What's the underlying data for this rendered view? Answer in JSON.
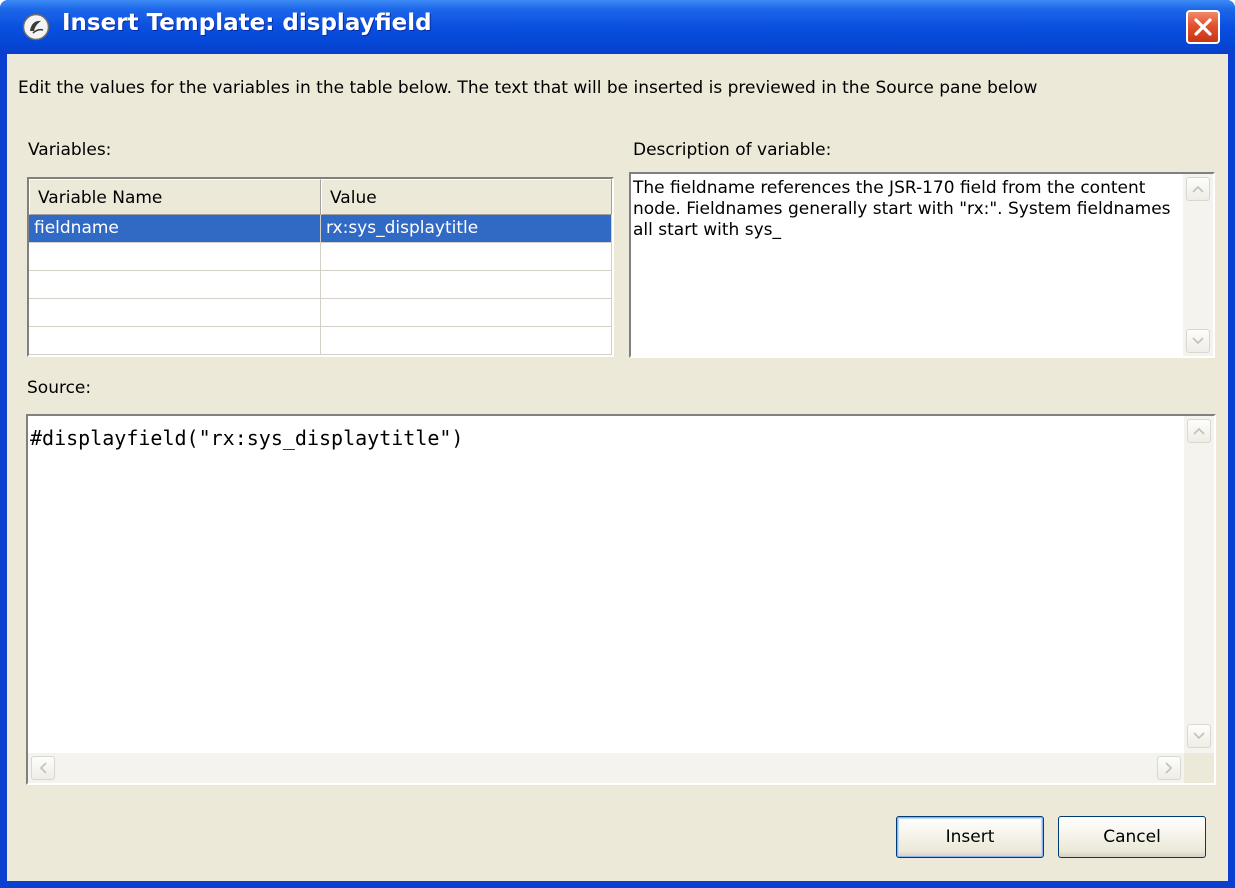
{
  "window": {
    "title": "Insert Template: displayfield"
  },
  "instructions": "Edit the values for the variables in the table below.  The text that will be inserted is previewed in the Source pane below",
  "variables": {
    "label": "Variables:",
    "columns": [
      "Variable Name",
      "Value"
    ],
    "rows": [
      {
        "name": "fieldname",
        "value": "rx:sys_displaytitle",
        "selected": true
      }
    ]
  },
  "description": {
    "label": "Description of variable:",
    "text": "The fieldname references the JSR-170 field from the content node. Fieldnames generally start with \"rx:\". System fieldnames all start with sys_"
  },
  "source": {
    "label": "Source:",
    "text": "#displayfield(\"rx:sys_displaytitle\")"
  },
  "buttons": {
    "insert": "Insert",
    "cancel": "Cancel"
  },
  "colors": {
    "titlebar": "#0a4fe0",
    "dialog_face": "#ece9d8",
    "selection": "#316ac5",
    "close_button": "#e2512f"
  },
  "icons": {
    "app": "app-logo-icon",
    "close": "close-icon",
    "scroll_up": "scroll-up-icon",
    "scroll_down": "scroll-down-icon",
    "scroll_left": "scroll-left-icon",
    "scroll_right": "scroll-right-icon"
  }
}
